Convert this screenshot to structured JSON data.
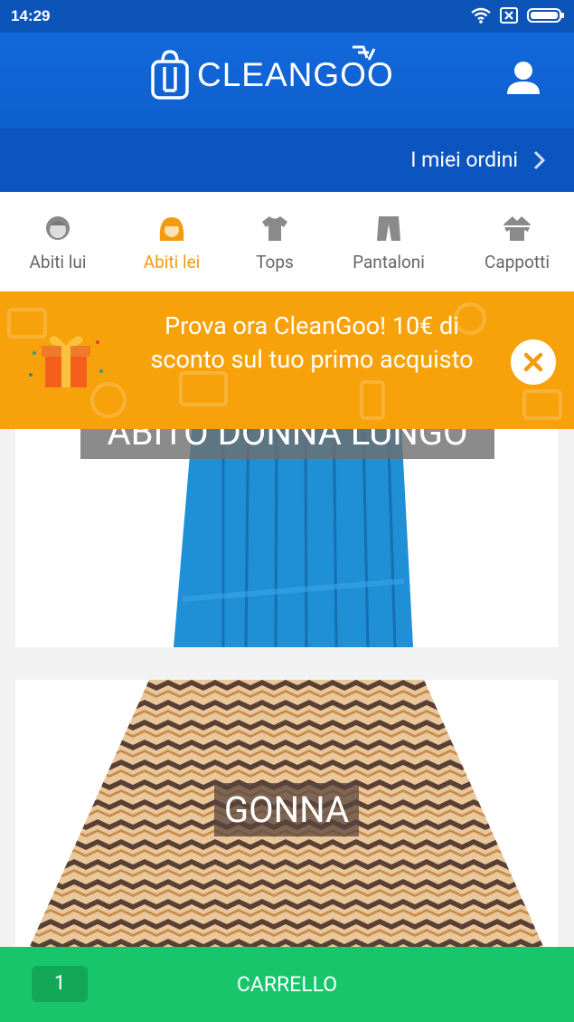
{
  "status_bar": {
    "time": "14:29"
  },
  "header": {
    "brand": "CLEANGOO"
  },
  "orders": {
    "label": "I miei ordini"
  },
  "tabs": [
    {
      "label": "Abiti lui",
      "icon": "man-face-icon"
    },
    {
      "label": "Abiti lei",
      "icon": "woman-face-icon"
    },
    {
      "label": "Tops",
      "icon": "tshirt-icon"
    },
    {
      "label": "Pantaloni",
      "icon": "trousers-icon"
    },
    {
      "label": "Cappotti",
      "icon": "coat-icon"
    }
  ],
  "promo": {
    "text": "Prova ora CleanGoo! 10€ di sconto sul tuo primo acquisto"
  },
  "products": [
    {
      "label": "ABITO DONNA LUNGO"
    },
    {
      "label": "GONNA"
    }
  ],
  "cart": {
    "count": "1",
    "label": "CARRELLO"
  },
  "colors": {
    "primary": "#1268db",
    "accent": "#f39b0f",
    "promo": "#f7a20a",
    "cart": "#18c56a"
  }
}
